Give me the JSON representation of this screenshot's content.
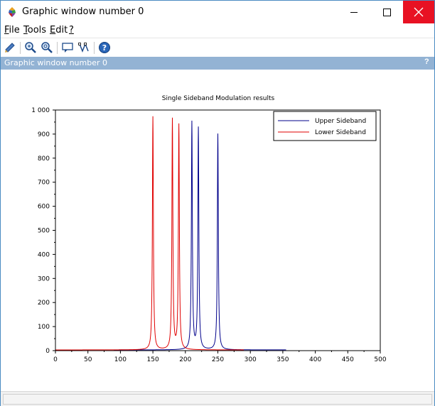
{
  "window": {
    "title": "Graphic window number 0"
  },
  "menu": [
    {
      "key": "F",
      "rest": "ile"
    },
    {
      "key": "T",
      "rest": "ools"
    },
    {
      "key": "E",
      "rest": "dit"
    },
    {
      "key": "?",
      "rest": ""
    }
  ],
  "toolbar": {
    "buttons": [
      "rotate-icon",
      "zoom-in-icon",
      "zoom-reset-icon",
      "datatip-icon",
      "edit-icon",
      "help-icon"
    ]
  },
  "panel": {
    "title": "Graphic window number 0",
    "help": "?"
  },
  "colors": {
    "upper": "#00008b",
    "lower": "#e00000",
    "panel": "#93b3d4",
    "close": "#e81123"
  },
  "chart_data": {
    "type": "line",
    "title": "Single Sideband Modulation results",
    "xlabel": "",
    "ylabel": "",
    "xlim": [
      0,
      500
    ],
    "ylim": [
      0,
      1000
    ],
    "x_ticks": [
      0,
      50,
      100,
      150,
      200,
      250,
      300,
      350,
      400,
      450,
      500
    ],
    "y_ticks": [
      0,
      100,
      200,
      300,
      400,
      500,
      600,
      700,
      800,
      900,
      1000
    ],
    "x_tick_labels": [
      "0",
      "50",
      "100",
      "150",
      "200",
      "250",
      "300",
      "350",
      "400",
      "450",
      "500"
    ],
    "y_tick_labels": [
      "0",
      "100",
      "200",
      "300",
      "400",
      "500",
      "600",
      "700",
      "800",
      "900",
      "1 000"
    ],
    "grid": false,
    "legend": "top-right",
    "series": [
      {
        "name": "Upper Sideband",
        "color": "#00008b",
        "range": [
          90,
          355
        ],
        "peaks": [
          {
            "x": 210,
            "y": 945
          },
          {
            "x": 220,
            "y": 920
          },
          {
            "x": 250,
            "y": 898
          }
        ]
      },
      {
        "name": "Lower Sideband",
        "color": "#e00000",
        "range": [
          0,
          290
        ],
        "peaks": [
          {
            "x": 150,
            "y": 970
          },
          {
            "x": 180,
            "y": 957
          },
          {
            "x": 190,
            "y": 933
          }
        ]
      }
    ]
  }
}
